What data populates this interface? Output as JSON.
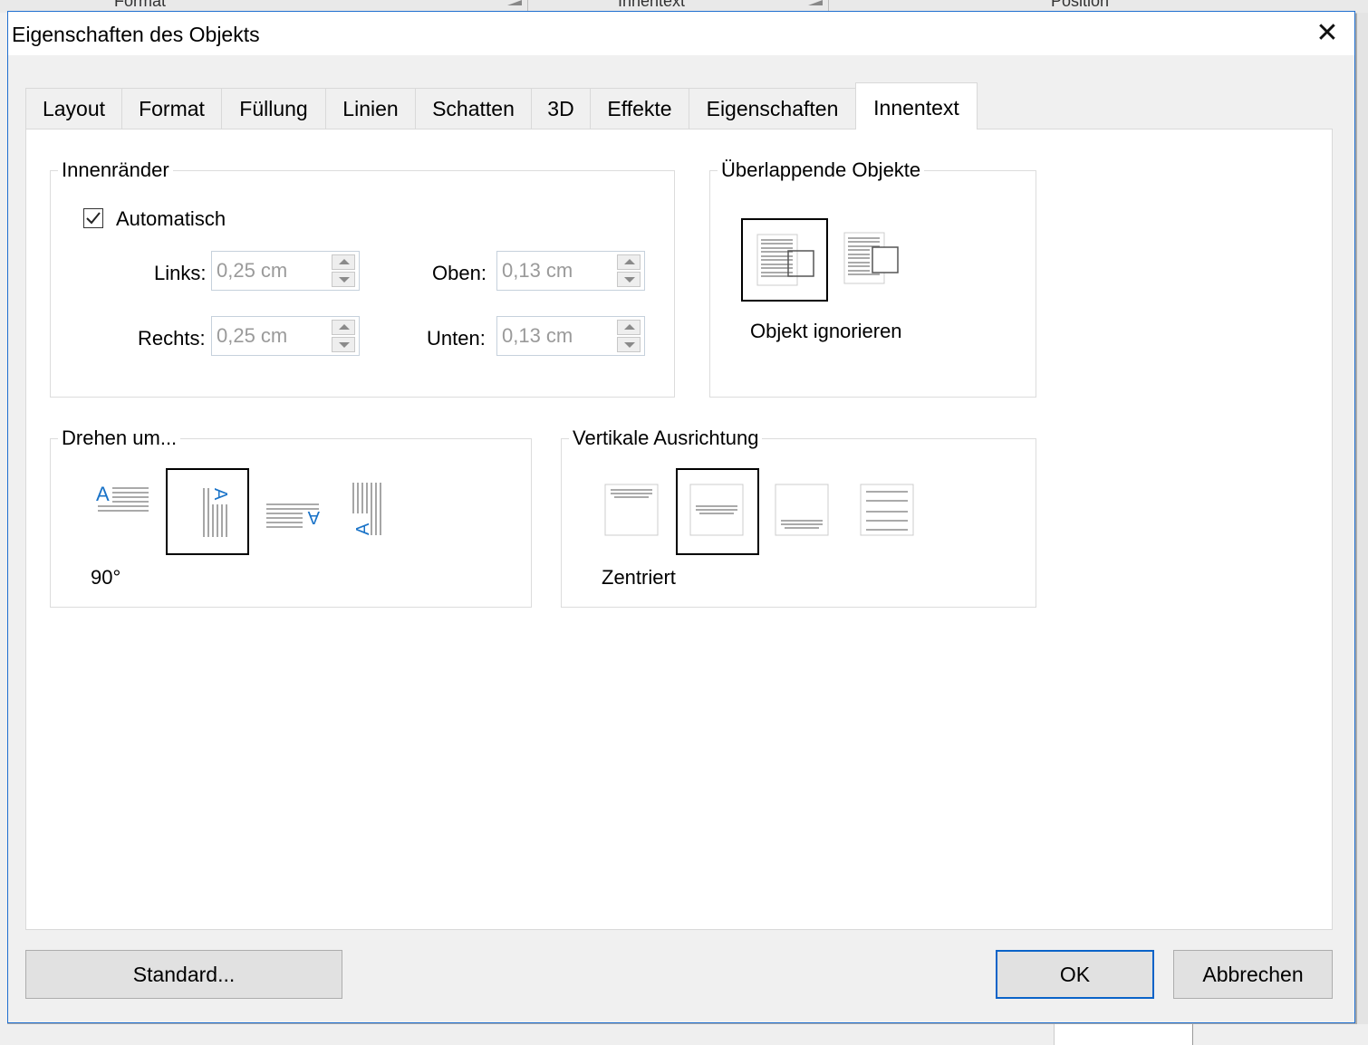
{
  "background": {
    "columns": [
      "Format",
      "Innentext",
      "Position"
    ]
  },
  "dialog": {
    "title": "Eigenschaften des Objekts",
    "close_glyph": "✕"
  },
  "tabs": [
    {
      "label": "Layout",
      "active": false
    },
    {
      "label": "Format",
      "active": false
    },
    {
      "label": "Füllung",
      "active": false
    },
    {
      "label": "Linien",
      "active": false
    },
    {
      "label": "Schatten",
      "active": false
    },
    {
      "label": "3D",
      "active": false
    },
    {
      "label": "Effekte",
      "active": false
    },
    {
      "label": "Eigenschaften",
      "active": false
    },
    {
      "label": "Innentext",
      "active": true
    }
  ],
  "innenraender": {
    "legend": "Innenränder",
    "auto_label": "Automatisch",
    "auto_checked": true,
    "links": {
      "label": "Links:",
      "value": "0,25 cm"
    },
    "oben": {
      "label": "Oben:",
      "value": "0,13 cm"
    },
    "rechts": {
      "label": "Rechts:",
      "value": "0,25 cm"
    },
    "unten": {
      "label": "Unten:",
      "value": "0,13 cm"
    }
  },
  "ueberlappend": {
    "legend": "Überlappende Objekte",
    "selected_label": "Objekt ignorieren",
    "options": [
      "objekt-ignorieren",
      "objekt-ausweichen"
    ],
    "selected_index": 0
  },
  "drehen": {
    "legend": "Drehen um...",
    "selected_label": "90°",
    "options": [
      "0°",
      "90°",
      "180°",
      "270°"
    ],
    "selected_index": 1
  },
  "vertikal": {
    "legend": "Vertikale Ausrichtung",
    "selected_label": "Zentriert",
    "options": [
      "oben",
      "zentriert",
      "unten",
      "blocksatz"
    ],
    "selected_index": 1
  },
  "footer": {
    "standard_label": "Standard...",
    "ok_label": "OK",
    "cancel_label": "Abbrechen"
  },
  "colors": {
    "accent": "#0a63c8",
    "text_blue": "#1a73c8",
    "disabled_text": "#9a9a9a"
  }
}
